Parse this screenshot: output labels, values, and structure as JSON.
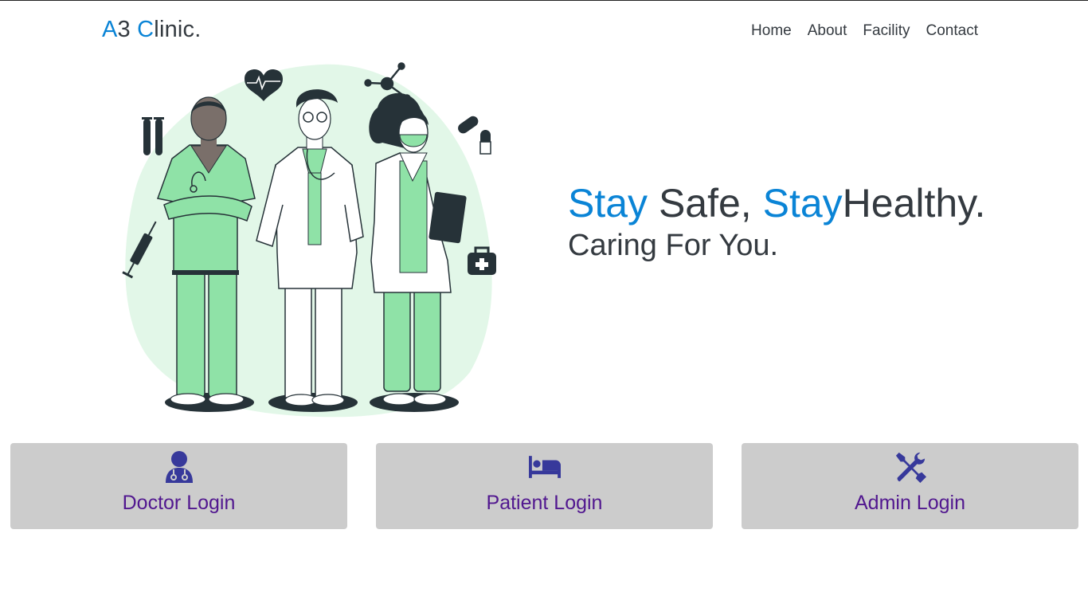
{
  "brand": {
    "a": "A",
    "three": "3 ",
    "c": "C",
    "rest": "linic."
  },
  "nav": {
    "home": "Home",
    "about": "About",
    "facility": "Facility",
    "contact": "Contact"
  },
  "hero": {
    "stay1": "Stay",
    "safe": " Safe, ",
    "stay2": "Stay",
    "healthy": "Healthy.",
    "subtitle": "Caring For You."
  },
  "cards": {
    "doctor": {
      "label": "Doctor Login",
      "icon": "user-doctor-icon"
    },
    "patient": {
      "label": "Patient Login",
      "icon": "bed-icon"
    },
    "admin": {
      "label": "Admin Login",
      "icon": "tools-icon"
    }
  },
  "colors": {
    "accent": "#0a84d6",
    "text": "#343a40",
    "card": "#cccccc",
    "card_label": "#51178f",
    "icon": "#37399b",
    "mint": "#8fe2a7"
  }
}
